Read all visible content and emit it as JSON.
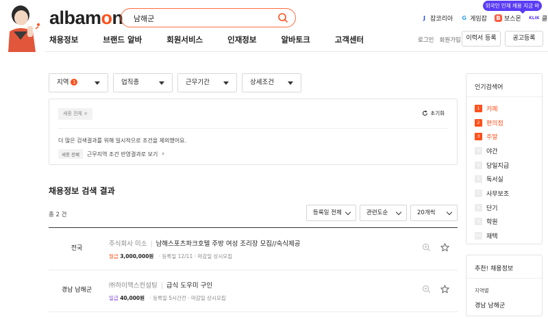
{
  "brand": {
    "logo_prefix": "albam",
    "logo_o": "o",
    "logo_suffix": "n",
    "accent": "#ff501b"
  },
  "search": {
    "value": "남해군"
  },
  "tooltip": "외국인 인재 채용 지금 바로!",
  "partners": [
    {
      "label": "잡코리아",
      "icon": "jobkorea-icon",
      "color": "#1d4ef5"
    },
    {
      "label": "게임잡",
      "icon": "gamejob-icon",
      "color": "#36a2eb"
    },
    {
      "label": "보스몬",
      "icon": "bossmon-icon",
      "color": "#ff5a3d"
    },
    {
      "label": "클릭",
      "icon": "klik-icon",
      "color": "#5b3cf5"
    }
  ],
  "nav": [
    "채용정보",
    "브랜드 알바",
    "회원서비스",
    "인재정보",
    "알바토크",
    "고객센터"
  ],
  "util": {
    "login": "로그인",
    "signup": "회원가입",
    "resume": "이력서 등록",
    "post": "공고등록"
  },
  "filters": {
    "region": "지역",
    "region_count": "1",
    "job": "업직종",
    "period": "근무기간",
    "detail": "상세조건"
  },
  "conditions": {
    "chip": "세종 전체",
    "reset": "초기화",
    "notice": "더 많은 검색결과를 위해 일시적으로 조건을 제외했어요.",
    "excluded_tag": "세종 전체",
    "excluded_text": "근무지역 조건 반영결과로 보기"
  },
  "results": {
    "title": "채용정보 검색 결과",
    "count": "총 2 건",
    "sort_date": "등록일 전체",
    "sort_rel": "관련도순",
    "per_page": "20개씩",
    "rows": [
      {
        "region": "전국",
        "company": "주식회사 미소",
        "title": "남해스포츠파크호텔 주방 여성 조리장 모집//숙식제공",
        "pay_type": "월급",
        "amount": "3,000,000원",
        "registered": "등록일 12/11",
        "deadline": "마감일 상시모집"
      },
      {
        "region": "경남 남해군",
        "company": "㈜하이맥스컨설팅",
        "title": "급식 도우미 구인",
        "pay_type": "일급",
        "amount": "40,000원",
        "registered": "등록일 5시간전",
        "deadline": "마감일 상시모집"
      }
    ]
  },
  "popular": {
    "title": "인기검색어",
    "items": [
      {
        "rank": "1",
        "label": "카페"
      },
      {
        "rank": "2",
        "label": "편의점"
      },
      {
        "rank": "3",
        "label": "주말"
      },
      {
        "rank": "4",
        "label": "야간"
      },
      {
        "rank": "5",
        "label": "당일지급"
      },
      {
        "rank": "6",
        "label": "독서실"
      },
      {
        "rank": "7",
        "label": "사무보조"
      },
      {
        "rank": "8",
        "label": "단기"
      },
      {
        "rank": "9",
        "label": "학원"
      },
      {
        "rank": "10",
        "label": "재택"
      }
    ]
  },
  "recommend": {
    "title": "추천! 채용정보",
    "sub": "지역별",
    "value": "경남 남해군"
  }
}
